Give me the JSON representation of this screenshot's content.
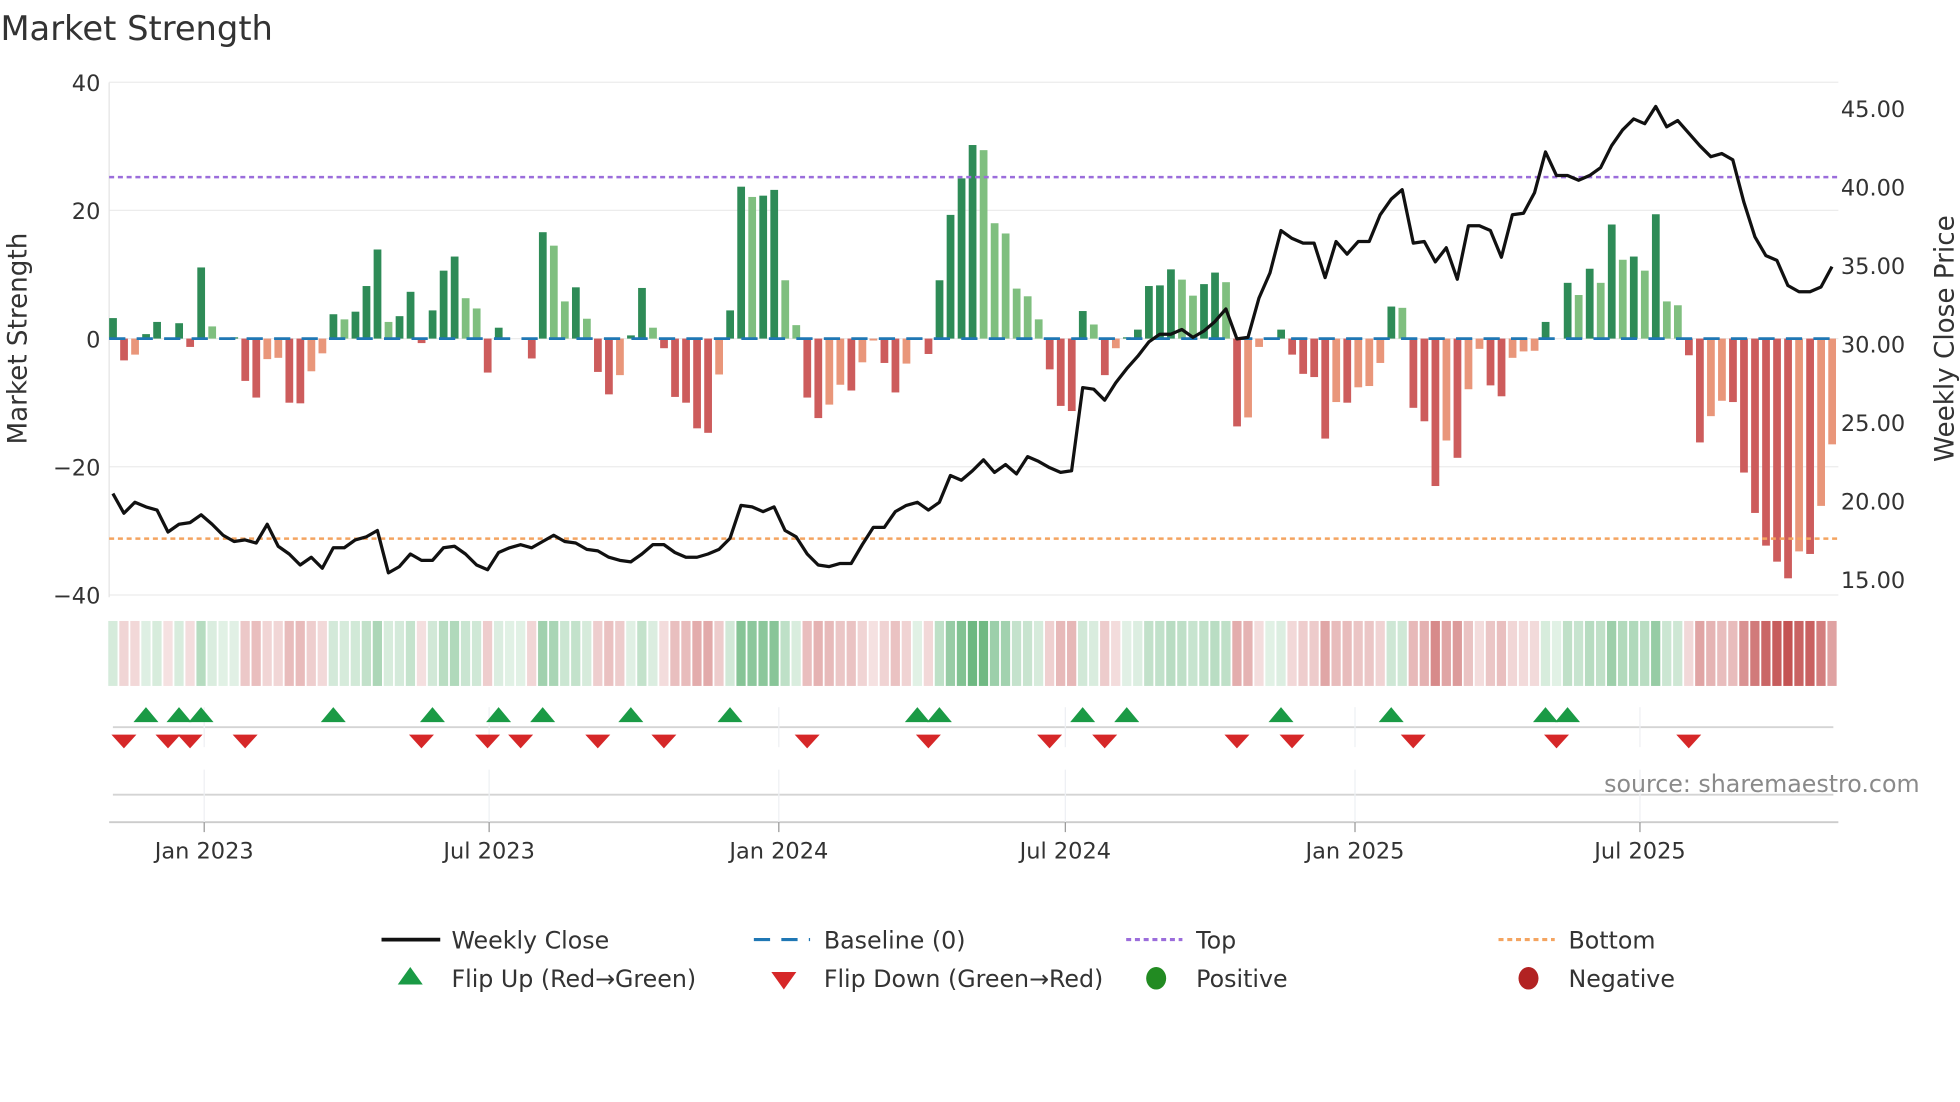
{
  "chart_data": {
    "type": "bar",
    "title": "Market Strength",
    "ylabel": "Market Strength",
    "y2label": "Weekly Close Price",
    "ylim": [
      -40,
      40
    ],
    "y2lim": [
      13.5,
      46.5
    ],
    "yticks": [
      40,
      20,
      0,
      -20,
      -40
    ],
    "yticks_labels": [
      "40",
      "20",
      "0",
      "−20",
      "−40"
    ],
    "y2ticks": [
      45,
      40,
      35,
      30,
      25,
      20,
      15
    ],
    "y2ticks_labels": [
      "45.00",
      "40.00",
      "35.00",
      "30.00",
      "25.00",
      "20.00",
      "15.00"
    ],
    "start_date": "2022-11-04",
    "frequency": "weekly",
    "xticks": [
      {
        "date": "2023-01-01",
        "label": "Jan 2023"
      },
      {
        "date": "2023-07-01",
        "label": "Jul 2023"
      },
      {
        "date": "2024-01-01",
        "label": "Jan 2024"
      },
      {
        "date": "2024-07-01",
        "label": "Jul 2024"
      },
      {
        "date": "2025-01-01",
        "label": "Jan 2025"
      },
      {
        "date": "2025-07-01",
        "label": "Jul 2025"
      }
    ],
    "top_level": 25.2,
    "bottom_level": -31.2,
    "baseline": 0,
    "strength": [
      3.2,
      -3.4,
      -2.5,
      0.7,
      2.6,
      -0.2,
      2.4,
      -1.3,
      11.1,
      1.9,
      0,
      0.2,
      -6.6,
      -9.2,
      -3.2,
      -3.0,
      -10,
      -10.1,
      -5.1,
      -2.3,
      3.8,
      3.0,
      4.2,
      8.2,
      13.9,
      2.6,
      3.5,
      7.3,
      -0.7,
      4.4,
      10.6,
      12.8,
      6.3,
      4.7,
      -5.3,
      1.7,
      0,
      0,
      -3.1,
      16.6,
      14.5,
      5.8,
      8.0,
      3.1,
      -5.2,
      -8.7,
      -5.7,
      0.5,
      7.9,
      1.7,
      -1.5,
      -9.1,
      -10,
      -14,
      -14.7,
      -5.6,
      4.4,
      23.7,
      22.1,
      22.3,
      23.2,
      9.1,
      2.1,
      -9.2,
      -12.4,
      -10.3,
      -7.2,
      -8.1,
      -3.7,
      -0.3,
      -3.8,
      -8.4,
      -3.9,
      0,
      -2.4,
      9.1,
      19.3,
      25,
      30.2,
      29.4,
      18,
      16.4,
      7.8,
      6.6,
      3.0,
      -4.8,
      -10.5,
      -11.3,
      4.3,
      2.2,
      -5.7,
      -1.5,
      0.2,
      1.4,
      8.2,
      8.3,
      10.8,
      9.2,
      6.7,
      8.5,
      10.3,
      8.8,
      -13.7,
      -12.3,
      -1.3,
      0,
      1.4,
      -2.5,
      -5.5,
      -6.0,
      -15.6,
      -9.9,
      -10,
      -7.6,
      -7.4,
      -3.8,
      5.0,
      4.8,
      -10.8,
      -12.9,
      -23,
      -15.9,
      -18.6,
      -7.9,
      -1.6,
      -7.3,
      -9.0,
      -3.0,
      -2.0,
      -1.9,
      2.6,
      0,
      8.7,
      6.8,
      10.9,
      8.7,
      17.8,
      12.3,
      12.8,
      10.6,
      19.4,
      5.8,
      5.2,
      -2.6,
      -16.2,
      -12.1,
      -9.7,
      -9.9,
      -20.9,
      -27.2,
      -32.3,
      -34.8,
      -37.4,
      -33.2,
      -33.6,
      -26.1,
      -16.5
    ],
    "weekly_close": [
      20.45,
      19.2,
      19.9,
      19.6,
      19.4,
      18.0,
      18.5,
      18.6,
      19.1,
      18.5,
      17.8,
      17.4,
      17.5,
      17.3,
      18.5,
      17.1,
      16.6,
      15.9,
      16.4,
      15.7,
      17.0,
      17.0,
      17.5,
      17.7,
      18.1,
      15.4,
      15.8,
      16.6,
      16.2,
      16.2,
      17.0,
      17.1,
      16.6,
      15.9,
      15.6,
      16.7,
      17.0,
      17.2,
      17.0,
      17.4,
      17.8,
      17.4,
      17.3,
      16.9,
      16.8,
      16.4,
      16.2,
      16.1,
      16.6,
      17.2,
      17.2,
      16.7,
      16.4,
      16.4,
      16.6,
      16.9,
      17.6,
      19.7,
      19.6,
      19.3,
      19.6,
      18.1,
      17.7,
      16.6,
      15.9,
      15.8,
      16.0,
      16.0,
      17.2,
      18.3,
      18.3,
      19.3,
      19.7,
      19.9,
      19.4,
      19.9,
      21.6,
      21.3,
      21.9,
      22.6,
      21.8,
      22.3,
      21.7,
      22.8,
      22.5,
      22.1,
      21.8,
      21.9,
      27.2,
      27.1,
      26.4,
      27.5,
      28.4,
      29.2,
      30.1,
      30.6,
      30.6,
      30.9,
      30.4,
      30.8,
      31.4,
      32.2,
      30.3,
      30.4,
      32.9,
      34.5,
      37.2,
      36.7,
      36.4,
      36.4,
      34.2,
      36.5,
      35.7,
      36.5,
      36.5,
      38.2,
      39.2,
      39.8,
      36.4,
      36.5,
      35.2,
      36.1,
      34.1,
      37.5,
      37.5,
      37.2,
      35.5,
      38.2,
      38.3,
      39.6,
      42.2,
      40.7,
      40.7,
      40.4,
      40.7,
      41.2,
      42.6,
      43.6,
      44.3,
      44.0,
      45.1,
      43.8,
      44.2,
      43.4,
      42.6,
      41.9,
      42.1,
      41.7,
      39.0,
      36.8,
      35.6,
      35.3,
      33.7,
      33.3,
      33.3,
      33.6,
      34.9
    ],
    "flip_up_weeks": [
      3,
      6,
      8,
      20,
      29,
      35,
      39,
      47,
      56,
      73,
      75,
      88,
      92,
      106,
      116,
      130,
      132
    ],
    "flip_down_weeks": [
      1,
      5,
      7,
      12,
      28,
      34,
      37,
      44,
      50,
      63,
      74,
      85,
      90,
      102,
      107,
      118,
      131,
      143
    ],
    "legend_placement": "bottom",
    "grid": true,
    "colors": {
      "strong_up": "#2e8b57",
      "weak_up": "#7fbf7f",
      "strong_down": "#cd5c5c",
      "weak_down": "#e9967a",
      "baseline": "#1f77b4",
      "top": "#9b6ddb",
      "bottom": "#f4a460",
      "close": "#111111",
      "flip_up": "#1a9a45",
      "flip_down": "#d62728",
      "positive": "#228b22",
      "negative": "#b22222"
    }
  },
  "legend": {
    "weekly_close": "Weekly Close",
    "baseline": "Baseline (0)",
    "top": "Top",
    "bottom": "Bottom",
    "flip_up": "Flip Up (Red→Green)",
    "flip_down": "Flip Down (Green→Red)",
    "positive": "Positive",
    "negative": "Negative"
  },
  "source": "source: sharemaestro.com"
}
